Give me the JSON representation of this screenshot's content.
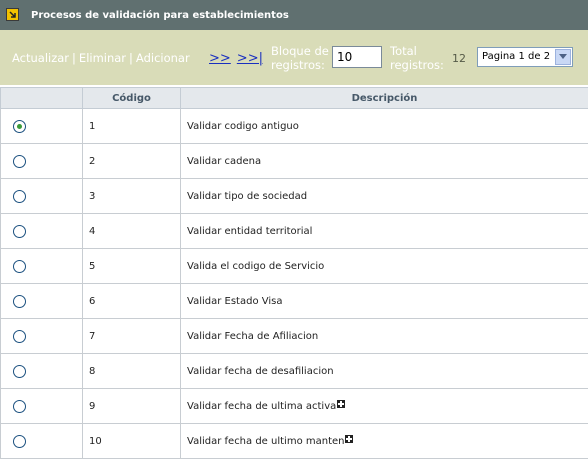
{
  "header": {
    "title": "Procesos de validación para establecimientos",
    "icon": "arrow-down-right-icon"
  },
  "toolbar": {
    "actions": [
      "Actualizar",
      "Eliminar",
      "Adicionar"
    ],
    "next_label": ">>",
    "last_label": ">>|",
    "block_label_1": "Bloque de",
    "block_label_2": "registros:",
    "block_value": "10",
    "total_label_1": "Total",
    "total_label_2": "registros:",
    "total_value": "12",
    "page_select": "Pagina 1 de 2"
  },
  "table": {
    "columns": [
      "",
      "Código",
      "Descripción"
    ],
    "rows": [
      {
        "selected": true,
        "codigo": "1",
        "descripcion": "Validar codigo antiguo"
      },
      {
        "selected": false,
        "codigo": "2",
        "descripcion": "Validar cadena"
      },
      {
        "selected": false,
        "codigo": "3",
        "descripcion": "Validar tipo de sociedad"
      },
      {
        "selected": false,
        "codigo": "4",
        "descripcion": "Validar entidad territorial"
      },
      {
        "selected": false,
        "codigo": "5",
        "descripcion": "Valida el codigo de Servicio"
      },
      {
        "selected": false,
        "codigo": "6",
        "descripcion": "Validar Estado Visa"
      },
      {
        "selected": false,
        "codigo": "7",
        "descripcion": "Validar Fecha de Afiliacion"
      },
      {
        "selected": false,
        "codigo": "8",
        "descripcion": "Validar fecha de desafiliacion"
      },
      {
        "selected": false,
        "codigo": "9",
        "descripcion": "Validar fecha de ultima activa",
        "expand": true
      },
      {
        "selected": false,
        "codigo": "10",
        "descripcion": "Validar fecha de ultimo manten",
        "expand": true
      }
    ]
  },
  "colors": {
    "title_bar": "#607070",
    "toolbar": "#d9dcb8",
    "link": "#1a2fbf",
    "header_bg": "#e4e8ec"
  }
}
